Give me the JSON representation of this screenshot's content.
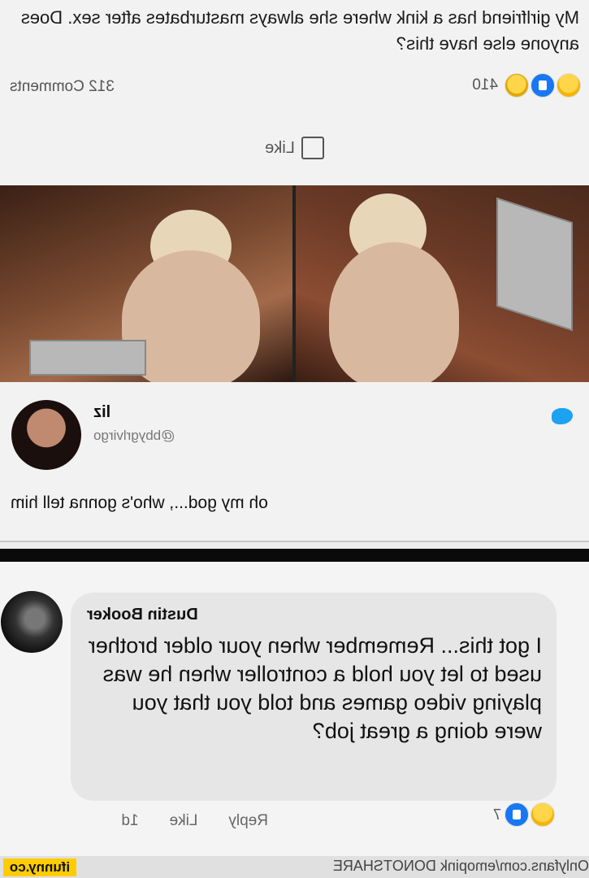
{
  "post": {
    "text": "My girlfriend has a kink where she always masturbates after sex. Does anyone else have this?",
    "reaction_count": "410",
    "comments_count": "312 Comments",
    "like_label": "Like"
  },
  "tweet": {
    "name": "liz",
    "handle": "@bbygrlvirgo",
    "text": "oh my god..., who's gonna tell him"
  },
  "comment": {
    "author": "Dustin Booker",
    "text": "I got this... Remember when your older brother used to let you hold a controller when he was playing video games and told you that you were doing a great job?",
    "reaction_count": "7",
    "time": "1d",
    "like_label": "Like",
    "reply_label": "Reply"
  },
  "footer": {
    "watermark": "Onlyfans.com/emopink DONOTSHARE",
    "ifunny": "ifunny.co"
  }
}
